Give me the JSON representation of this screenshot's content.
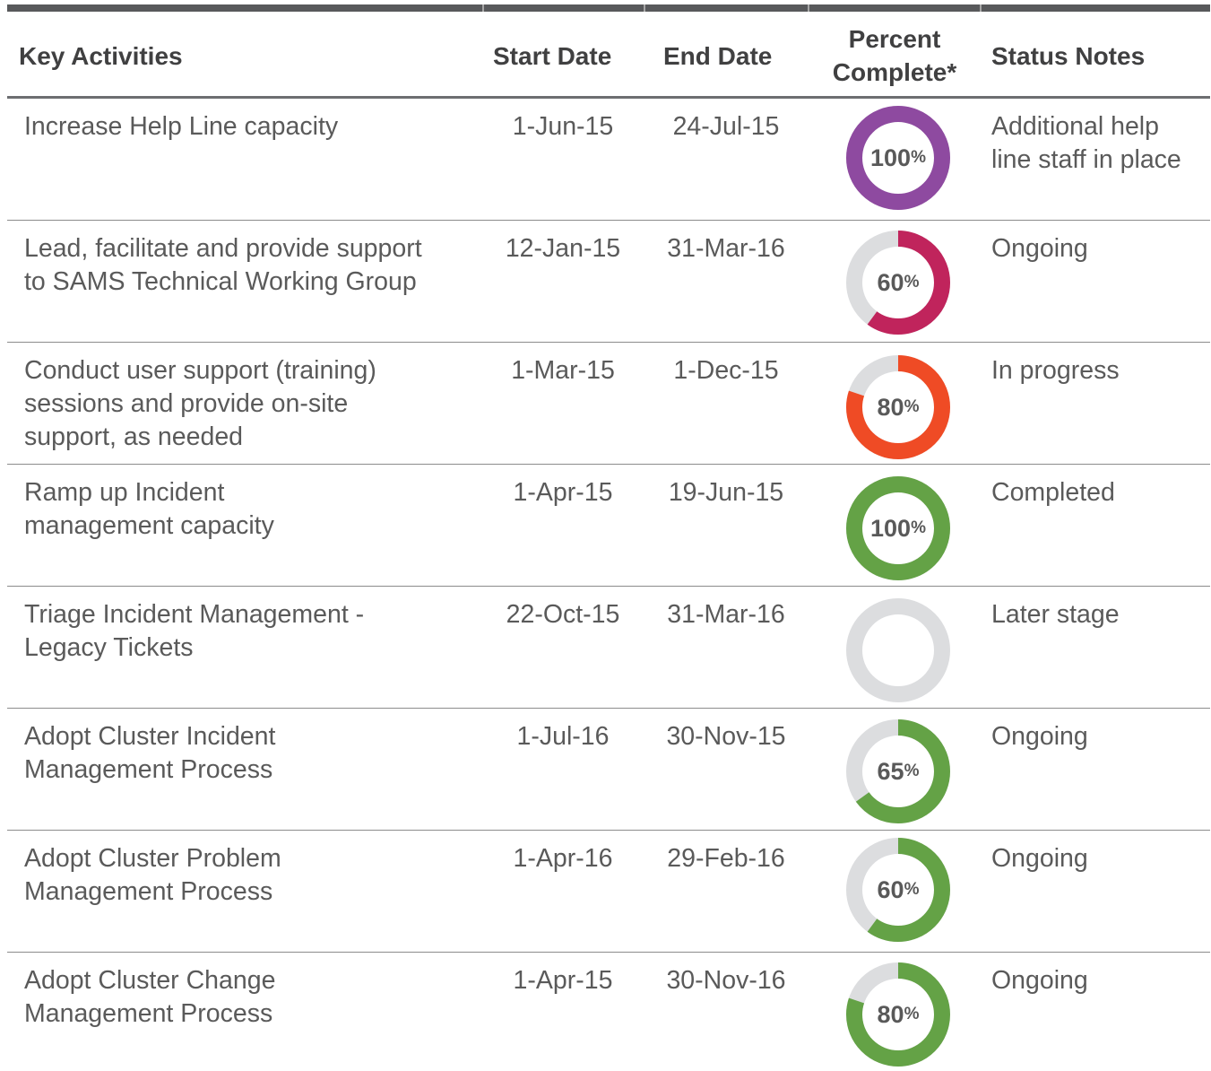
{
  "header": {
    "activities": "Key Activities",
    "start": "Start Date",
    "end": "End Date",
    "percent_line1": "Percent",
    "percent_line2": "Complete*",
    "notes": "Status Notes"
  },
  "colors": {
    "track": "#dcdddf",
    "purple": "#8e4aa0",
    "magenta": "#c0245c",
    "orange": "#ef4b25",
    "green": "#64a246"
  },
  "rows": [
    {
      "activity": [
        "Increase Help Line capacity"
      ],
      "start": "1-Jun-15",
      "end": "24-Jul-15",
      "percent": 100,
      "percent_text": "100",
      "color": "#8e4aa0",
      "notes": [
        "Additional help",
        "line staff in place"
      ]
    },
    {
      "activity": [
        "Lead, facilitate and provide support",
        "to SAMS Technical Working Group"
      ],
      "start": "12-Jan-15",
      "end": "31-Mar-16",
      "percent": 60,
      "percent_text": "60",
      "color": "#c0245c",
      "notes": [
        "Ongoing"
      ]
    },
    {
      "activity": [
        "Conduct user support (training)",
        "sessions and provide on-site",
        "support, as needed"
      ],
      "start": "1-Mar-15",
      "end": "1-Dec-15",
      "percent": 80,
      "percent_text": "80",
      "color": "#ef4b25",
      "notes": [
        "In progress"
      ]
    },
    {
      "activity": [
        "Ramp up Incident",
        "management capacity"
      ],
      "start": "1-Apr-15",
      "end": "19-Jun-15",
      "percent": 100,
      "percent_text": "100",
      "color": "#64a246",
      "notes": [
        "Completed"
      ]
    },
    {
      "activity": [
        "Triage Incident Management -",
        "Legacy Tickets"
      ],
      "start": "22-Oct-15",
      "end": "31-Mar-16",
      "percent": 0,
      "percent_text": "",
      "color": "#64a246",
      "notes": [
        "Later stage"
      ]
    },
    {
      "activity": [
        "Adopt Cluster Incident",
        "Management Process"
      ],
      "start": "1-Jul-16",
      "end": "30-Nov-15",
      "percent": 65,
      "percent_text": "65",
      "color": "#64a246",
      "notes": [
        "Ongoing"
      ]
    },
    {
      "activity": [
        "Adopt Cluster Problem",
        "Management Process"
      ],
      "start": "1-Apr-16",
      "end": "29-Feb-16",
      "percent": 60,
      "percent_text": "60",
      "color": "#64a246",
      "notes": [
        "Ongoing"
      ]
    },
    {
      "activity": [
        "Adopt Cluster Change",
        "Management Process"
      ],
      "start": "1-Apr-15",
      "end": "30-Nov-16",
      "percent": 80,
      "percent_text": "80",
      "color": "#64a246",
      "notes": [
        "Ongoing"
      ]
    }
  ],
  "percent_sign": "%"
}
